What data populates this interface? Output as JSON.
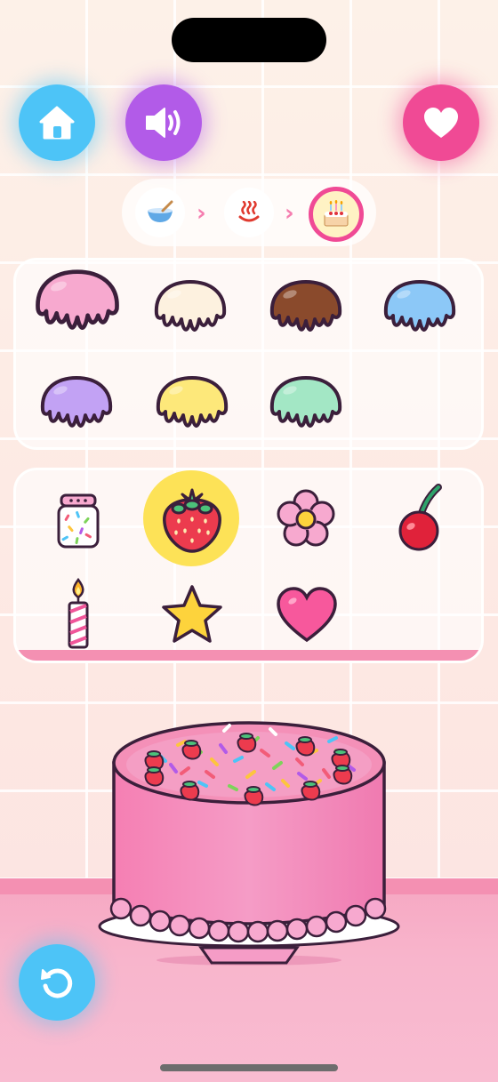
{
  "colors": {
    "accent_blue": "#4dc4f7",
    "accent_purple": "#b25be8",
    "accent_pink": "#f04a95",
    "selected_highlight": "#fde257"
  },
  "toolbar": {
    "home_icon": "home-icon",
    "sound_icon": "speaker-icon",
    "favorite_icon": "heart-icon",
    "undo_icon": "undo-icon"
  },
  "steps": [
    {
      "name": "mix",
      "icon": "bowl-icon",
      "glyph": "🥣"
    },
    {
      "name": "bake",
      "icon": "heat-icon",
      "glyph": "♨"
    },
    {
      "name": "decorate",
      "icon": "cake-icon",
      "glyph": "🎂",
      "active": true
    }
  ],
  "frostings": [
    {
      "name": "pink",
      "color": "#f7a9cf"
    },
    {
      "name": "vanilla",
      "color": "#fdf1df"
    },
    {
      "name": "chocolate",
      "color": "#8a4a2c"
    },
    {
      "name": "blue",
      "color": "#8cc8f7"
    },
    {
      "name": "lavender",
      "color": "#c2a2f4"
    },
    {
      "name": "lemon",
      "color": "#fde87a"
    },
    {
      "name": "mint",
      "color": "#a3e7c5"
    }
  ],
  "toppings": [
    {
      "name": "sprinkles",
      "icon": "sprinkles-jar-icon"
    },
    {
      "name": "strawberry",
      "icon": "strawberry-icon",
      "selected": true
    },
    {
      "name": "flower",
      "icon": "flower-icon"
    },
    {
      "name": "cherry",
      "icon": "cherry-icon"
    },
    {
      "name": "candle",
      "icon": "candle-icon"
    },
    {
      "name": "star",
      "icon": "star-icon"
    },
    {
      "name": "heart",
      "icon": "heart-topping-icon"
    }
  ],
  "cake": {
    "frosting": "pink",
    "toppings_on_cake": [
      "sprinkles",
      "strawberry"
    ]
  }
}
